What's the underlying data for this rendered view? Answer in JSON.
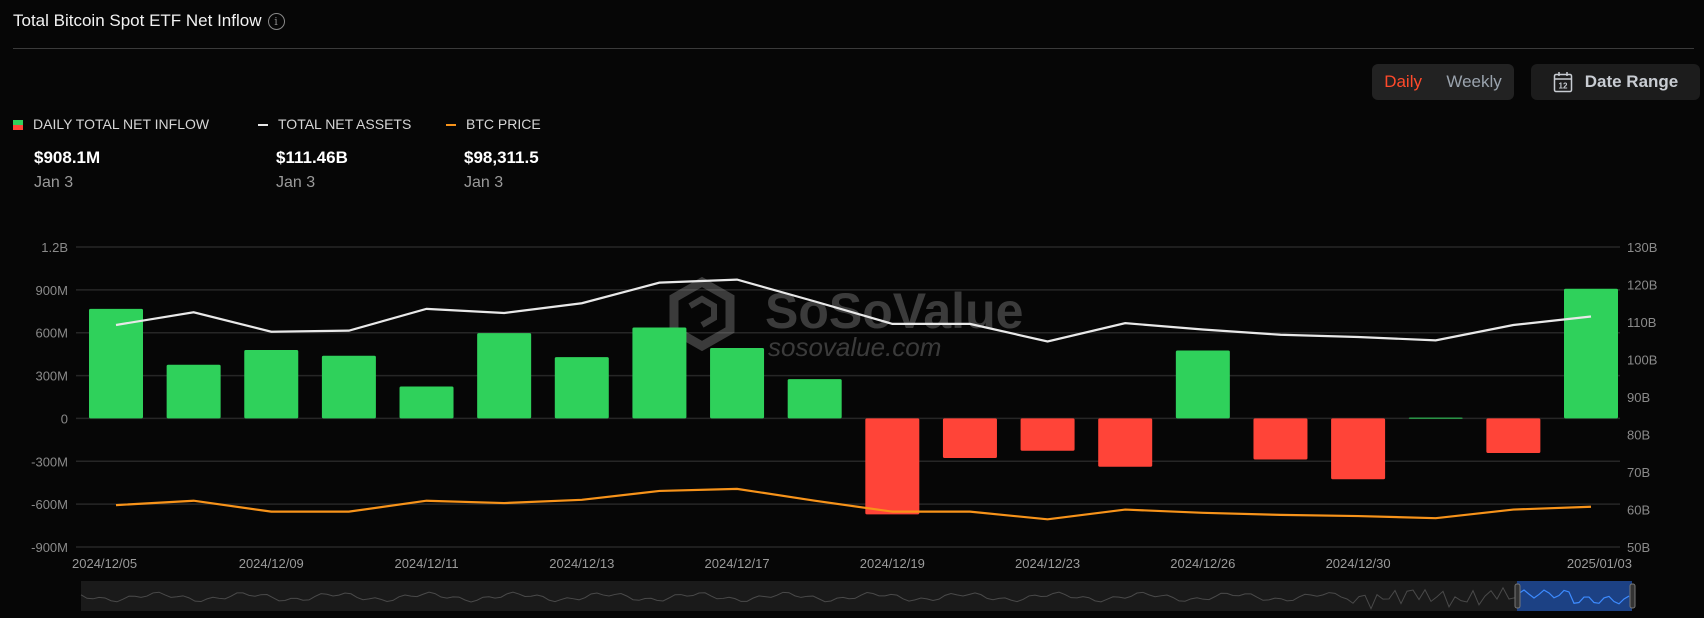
{
  "header": {
    "title": "Total Bitcoin Spot ETF Net Inflow",
    "info_icon": "info-circle-icon"
  },
  "controls": {
    "daily": "Daily",
    "weekly": "Weekly",
    "date_range": "Date Range",
    "calendar_icon": "calendar-icon",
    "calendar_day": "12",
    "active": "Daily",
    "active_color": "#ff4a2b"
  },
  "legend": [
    {
      "label": "DAILY TOTAL NET INFLOW",
      "value": "$908.1M",
      "date": "Jan 3",
      "colors": [
        "#2fd15b",
        "#ff4438"
      ]
    },
    {
      "label": "TOTAL NET ASSETS",
      "value": "$111.46B",
      "date": "Jan 3",
      "color": "#e8e8e8"
    },
    {
      "label": "BTC PRICE",
      "value": "$98,311.5",
      "date": "Jan 3",
      "color": "#f7931a"
    }
  ],
  "watermark": {
    "brand": "SoSoValue",
    "url": "sosovalue.com"
  },
  "chart_data": {
    "type": "bar+line",
    "dates": [
      "2024/12/05",
      "2024/12/06",
      "2024/12/09",
      "2024/12/10",
      "2024/12/11",
      "2024/12/12",
      "2024/12/13",
      "2024/12/16",
      "2024/12/17",
      "2024/12/18",
      "2024/12/19",
      "2024/12/20",
      "2024/12/23",
      "2024/12/24",
      "2024/12/26",
      "2024/12/27",
      "2024/12/30",
      "2024/12/31",
      "2025/01/02",
      "2025/01/03"
    ],
    "x_tick_labels": [
      "2024/12/05",
      "2024/12/09",
      "2024/12/11",
      "2024/12/13",
      "2024/12/17",
      "2024/12/19",
      "2024/12/23",
      "2024/12/26",
      "2024/12/30",
      "2025/01/03"
    ],
    "left_axis": {
      "unit": "USD",
      "ylim": [
        -900000000,
        1200000000
      ],
      "ticks": [
        "1.2B",
        "900M",
        "600M",
        "300M",
        "0",
        "-300M",
        "-600M",
        "-900M"
      ]
    },
    "right_axis": {
      "unit": "USD",
      "ylim": [
        50,
        130
      ],
      "ticks": [
        "130B",
        "120B",
        "110B",
        "100B",
        "90B",
        "80B",
        "70B",
        "60B",
        "50B"
      ]
    },
    "series": [
      {
        "name": "DAILY TOTAL NET INFLOW",
        "type": "bar",
        "axis": "left",
        "unit": "M USD",
        "positive_color": "#2fd15b",
        "negative_color": "#ff4438",
        "values": [
          766.7,
          375.9,
          479.3,
          438.5,
          223.1,
          597.1,
          428.9,
          636.9,
          493.3,
          275.2,
          -671.9,
          -277.2,
          -226.5,
          -338.4,
          475.2,
          -287.7,
          -426.1,
          5.3,
          -242.3,
          908.1
        ]
      },
      {
        "name": "TOTAL NET ASSETS",
        "type": "line",
        "axis": "right",
        "unit": "B USD",
        "color": "#e8e8e8",
        "values": [
          109.2,
          112.6,
          107.4,
          107.7,
          113.5,
          112.4,
          115.0,
          120.5,
          121.3,
          115.5,
          109.5,
          109.5,
          104.8,
          109.7,
          108.0,
          106.6,
          106.0,
          105.1,
          109.2,
          111.46
        ]
      },
      {
        "name": "BTC PRICE",
        "type": "line",
        "axis": "hidden",
        "unit": "USD",
        "color": "#f7931a",
        "values": [
          99000,
          100900,
          96200,
          96200,
          100900,
          99900,
          101300,
          105100,
          106000,
          100900,
          96200,
          96200,
          92900,
          97100,
          95700,
          94800,
          94300,
          93400,
          97100,
          98311.5
        ]
      }
    ],
    "grid": true,
    "legend_position": "top-left",
    "navigator": {
      "selected": "last month",
      "selected_color": "#1e4fa8"
    }
  }
}
